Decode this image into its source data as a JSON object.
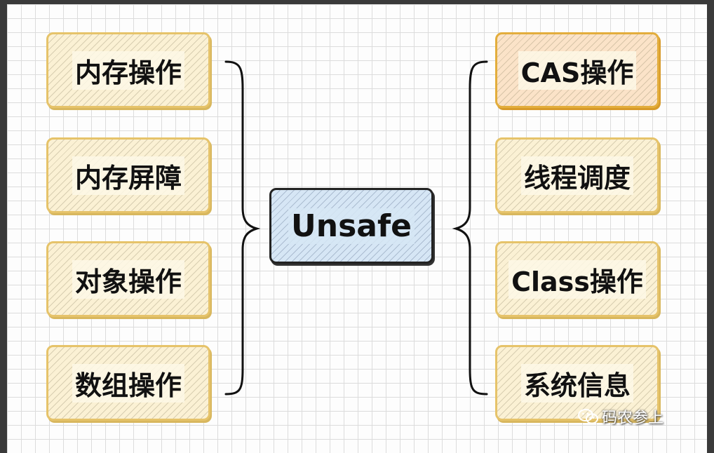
{
  "center": {
    "label": "Unsafe"
  },
  "left_items": [
    "内存操作",
    "内存屏障",
    "对象操作",
    "数组操作"
  ],
  "right_items": [
    "CAS操作",
    "线程调度",
    "Class操作",
    "系统信息"
  ],
  "watermark": {
    "text": "码农参上",
    "icon": "wechat-icon"
  },
  "colors": {
    "yellow_border": "#e6c36a",
    "orange_border": "#e3ad3c",
    "blue_fill": "#d6e6f5",
    "grid": "#dcdcdc"
  }
}
